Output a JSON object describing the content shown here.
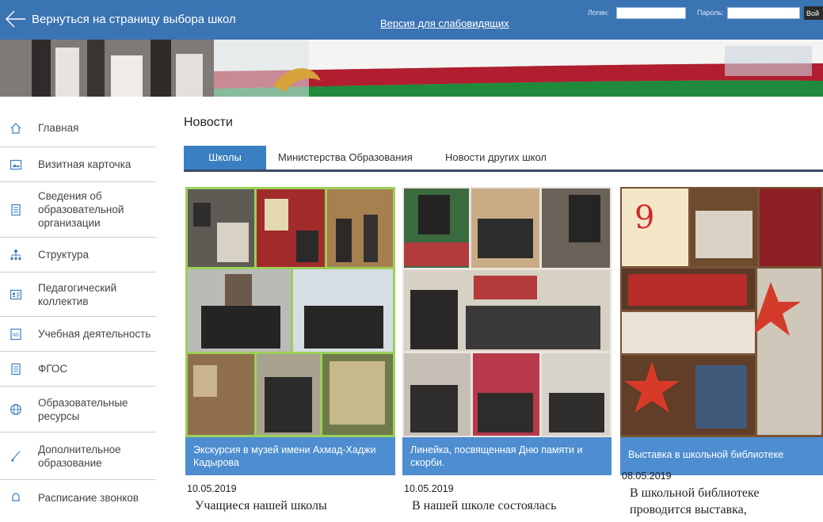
{
  "header": {
    "back_label": "Вернуться на страницу выбора школ",
    "vision_link": "Версия для слабовидящих",
    "login_label": "Логин:",
    "password_label": "Пароль:",
    "login_button": "Вой"
  },
  "sidebar": {
    "items": [
      {
        "label": "Главная",
        "icon": "home-icon"
      },
      {
        "label": "Визитная карточка",
        "icon": "card-icon"
      },
      {
        "label": "Сведения об образовательной организации",
        "icon": "document-icon"
      },
      {
        "label": "Структура",
        "icon": "structure-icon"
      },
      {
        "label": "Педагогический коллектив",
        "icon": "staff-icon"
      },
      {
        "label": "Учебная деятельность",
        "icon": "study-icon"
      },
      {
        "label": "ФГОС",
        "icon": "document-icon"
      },
      {
        "label": "Образовательные ресурсы",
        "icon": "globe-icon"
      },
      {
        "label": "Дополнительное образование",
        "icon": "pen-icon"
      },
      {
        "label": "Расписание звонков",
        "icon": "bell-icon"
      }
    ]
  },
  "main": {
    "title": "Новости",
    "tabs": [
      {
        "label": "Школы",
        "active": true
      },
      {
        "label": "Министерства Образования",
        "active": false
      },
      {
        "label": "Новости других школ",
        "active": false
      }
    ],
    "news": [
      {
        "caption": "Экскурсия в музей имени Ахмад-Хаджи Кадырова",
        "date": "10.05.2019",
        "excerpt": "Учащиеся нашей школы"
      },
      {
        "caption": "Линейка, посвященная Дню памяти и скорби.",
        "date": "10.05.2019",
        "excerpt": "В нашей школе состоялась"
      },
      {
        "caption": "Выставка в школьной библиотеке",
        "date": "08.05.2019",
        "excerpt": "В школьной библиотеке проводится выставка,"
      }
    ]
  },
  "colors": {
    "header_bg": "#3a74b3",
    "tab_active": "#3a7fc1",
    "caption_bg": "#4d8dd0",
    "tab_underline": "#3b4d6a"
  }
}
